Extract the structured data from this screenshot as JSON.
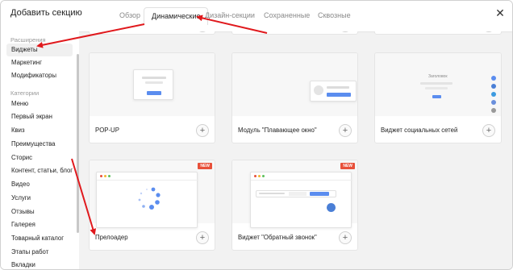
{
  "dialog": {
    "title": "Добавить секцию"
  },
  "tabs": [
    {
      "label": "Обзор",
      "active": false
    },
    {
      "label": "Динамические",
      "active": true
    },
    {
      "label": "Дизайн-секции",
      "active": false
    },
    {
      "label": "Сохраненные",
      "active": false
    },
    {
      "label": "Сквозные",
      "active": false
    }
  ],
  "sidebar": {
    "section_extensions": "Расширения",
    "ext_items": [
      "Виджеты",
      "Маркетинг",
      "Модификаторы"
    ],
    "section_categories": "Категории",
    "cat_items": [
      "Меню",
      "Первый экран",
      "Квиз",
      "Преимущества",
      "Сторис",
      "Контент, статьи, блог",
      "Видео",
      "Услуги",
      "Отзывы",
      "Галерея",
      "Товарный каталог",
      "Этапы работ",
      "Вкладки"
    ]
  },
  "cards": [
    {
      "label": "POP-UP",
      "new": false
    },
    {
      "label": "Модуль \"Плавающее окно\"",
      "new": false
    },
    {
      "label": "Виджет социальных сетей",
      "new": false,
      "preview_title": "Заголовок"
    },
    {
      "label": "Прелоадер",
      "new": true
    },
    {
      "label": "Виджет \"Обратный звонок\"",
      "new": true
    }
  ],
  "badge_new": "NEW",
  "colors": {
    "accent_blue": "#5b8def",
    "arrow_red": "#e0191d",
    "badge_red": "#e8503a"
  }
}
